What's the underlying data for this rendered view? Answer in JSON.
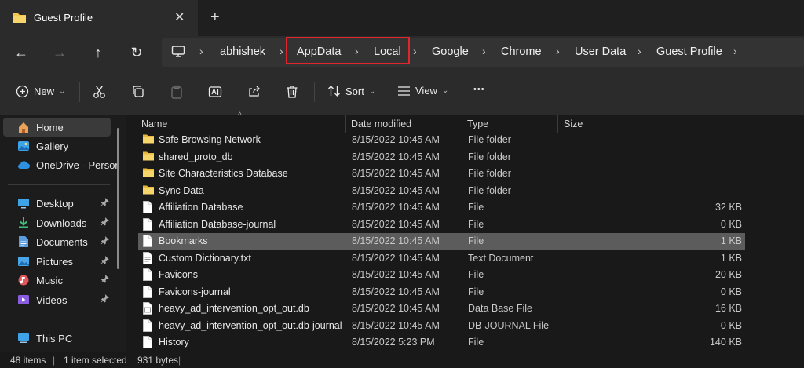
{
  "window": {
    "tab_title": "Guest Profile",
    "close_glyph": "✕",
    "new_tab_glyph": "+"
  },
  "nav": {
    "back_glyph": "←",
    "forward_glyph": "→",
    "up_glyph": "↑",
    "refresh_glyph": "↻",
    "breadcrumbs": [
      "abhishek",
      "AppData",
      "Local",
      "Google",
      "Chrome",
      "User Data",
      "Guest Profile"
    ],
    "separator": "›",
    "highlighted": [
      "AppData",
      "Local"
    ],
    "highlight_color": "#e0262c"
  },
  "toolbar": {
    "new_label": "New",
    "sort_label": "Sort",
    "view_label": "View",
    "more_glyph": "•••",
    "chevron": "⌄"
  },
  "sidebar": {
    "items": [
      {
        "label": "Home",
        "icon": "home-icon",
        "active": true
      },
      {
        "label": "Gallery",
        "icon": "gallery-icon"
      },
      {
        "label": "OneDrive - Persor",
        "icon": "onedrive-icon"
      },
      {
        "label": "Desktop",
        "icon": "desktop-icon",
        "pinned": true
      },
      {
        "label": "Downloads",
        "icon": "downloads-icon",
        "pinned": true
      },
      {
        "label": "Documents",
        "icon": "documents-icon",
        "pinned": true
      },
      {
        "label": "Pictures",
        "icon": "pictures-icon",
        "pinned": true
      },
      {
        "label": "Music",
        "icon": "music-icon",
        "pinned": true
      },
      {
        "label": "Videos",
        "icon": "videos-icon",
        "pinned": true
      },
      {
        "label": "This PC",
        "icon": "this-pc-icon"
      }
    ],
    "pin_glyph": "📌"
  },
  "columns": {
    "name": "Name",
    "date": "Date modified",
    "type": "Type",
    "size": "Size",
    "sort_glyph": "^"
  },
  "files": [
    {
      "name": "Safe Browsing Network",
      "date": "8/15/2022 10:45 AM",
      "type": "File folder",
      "size": "",
      "kind": "folder"
    },
    {
      "name": "shared_proto_db",
      "date": "8/15/2022 10:45 AM",
      "type": "File folder",
      "size": "",
      "kind": "folder"
    },
    {
      "name": "Site Characteristics Database",
      "date": "8/15/2022 10:45 AM",
      "type": "File folder",
      "size": "",
      "kind": "folder"
    },
    {
      "name": "Sync Data",
      "date": "8/15/2022 10:45 AM",
      "type": "File folder",
      "size": "",
      "kind": "folder"
    },
    {
      "name": "Affiliation Database",
      "date": "8/15/2022 10:45 AM",
      "type": "File",
      "size": "32 KB",
      "kind": "file"
    },
    {
      "name": "Affiliation Database-journal",
      "date": "8/15/2022 10:45 AM",
      "type": "File",
      "size": "0 KB",
      "kind": "file"
    },
    {
      "name": "Bookmarks",
      "date": "8/15/2022 10:45 AM",
      "type": "File",
      "size": "1 KB",
      "kind": "file",
      "selected": true
    },
    {
      "name": "Custom Dictionary.txt",
      "date": "8/15/2022 10:45 AM",
      "type": "Text Document",
      "size": "1 KB",
      "kind": "text"
    },
    {
      "name": "Favicons",
      "date": "8/15/2022 10:45 AM",
      "type": "File",
      "size": "20 KB",
      "kind": "file"
    },
    {
      "name": "Favicons-journal",
      "date": "8/15/2022 10:45 AM",
      "type": "File",
      "size": "0 KB",
      "kind": "file"
    },
    {
      "name": "heavy_ad_intervention_opt_out.db",
      "date": "8/15/2022 10:45 AM",
      "type": "Data Base File",
      "size": "16 KB",
      "kind": "db"
    },
    {
      "name": "heavy_ad_intervention_opt_out.db-journal",
      "date": "8/15/2022 10:45 AM",
      "type": "DB-JOURNAL File",
      "size": "0 KB",
      "kind": "file"
    },
    {
      "name": "History",
      "date": "8/15/2022 5:23 PM",
      "type": "File",
      "size": "140 KB",
      "kind": "file"
    }
  ],
  "status": {
    "items": "48 items",
    "selected": "1 item selected",
    "size": "931 bytes",
    "divider": "|"
  },
  "colors": {
    "folder": "#f2c94c",
    "selection": "#5c5c5c",
    "accent": "#e0262c"
  }
}
